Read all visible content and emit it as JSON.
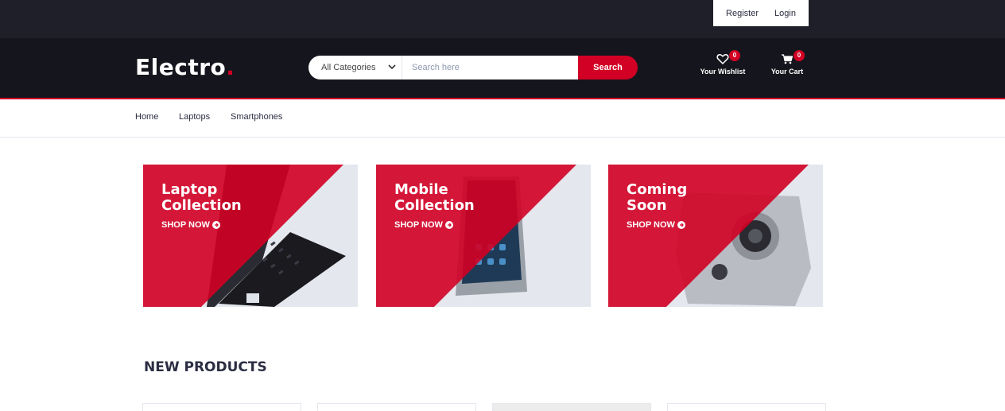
{
  "top_bar": {
    "register_label": "Register",
    "login_label": "Login"
  },
  "header": {
    "logo_text": "Electro",
    "logo_dot": ".",
    "search": {
      "category_selected": "All Categories",
      "placeholder": "Search here",
      "button_label": "Search"
    },
    "wishlist": {
      "label": "Your Wishlist",
      "count": "0",
      "icon": "heart-icon"
    },
    "cart": {
      "label": "Your Cart",
      "count": "0",
      "icon": "cart-icon"
    }
  },
  "nav": {
    "items": [
      {
        "label": "Home"
      },
      {
        "label": "Laptops"
      },
      {
        "label": "Smartphones"
      }
    ]
  },
  "collections": [
    {
      "line1": "Laptop",
      "line2": "Collection",
      "cta": "SHOP NOW",
      "image": "laptop"
    },
    {
      "line1": "Mobile",
      "line2": "Collection",
      "cta": "SHOP NOW",
      "image": "smartphone"
    },
    {
      "line1": "Coming",
      "line2": "Soon",
      "cta": "SHOP NOW",
      "image": "camera"
    }
  ],
  "section": {
    "title": "NEW PRODUCTS"
  },
  "colors": {
    "accent": "#D10024",
    "header_dark": "#15161D",
    "top_bar": "#1E1F29",
    "card_bg": "#E4E7ED"
  }
}
